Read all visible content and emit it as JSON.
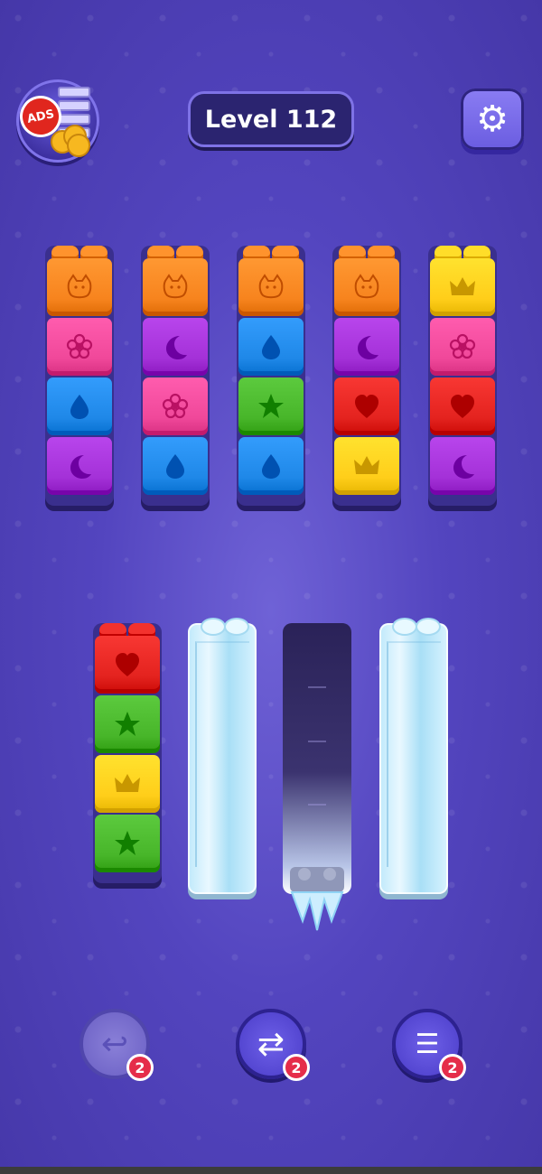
{
  "header": {
    "ads_badge": "ADS",
    "level_label": "Level 112",
    "settings_icon": "gear-icon"
  },
  "colors": {
    "orange": "#f7841e",
    "pink": "#f0489a",
    "blue": "#1f88e8",
    "purple": "#a431d8",
    "green": "#48b62a",
    "red": "#e4231f",
    "yellow": "#ffce1a"
  },
  "board": {
    "top_tubes": [
      {
        "blocks": [
          {
            "color": "orange",
            "icon": "cat"
          },
          {
            "color": "pink",
            "icon": "flower"
          },
          {
            "color": "blue",
            "icon": "drop"
          },
          {
            "color": "purple",
            "icon": "moon"
          }
        ]
      },
      {
        "blocks": [
          {
            "color": "orange",
            "icon": "cat"
          },
          {
            "color": "purple",
            "icon": "moon"
          },
          {
            "color": "pink",
            "icon": "flower"
          },
          {
            "color": "blue",
            "icon": "drop"
          }
        ]
      },
      {
        "blocks": [
          {
            "color": "orange",
            "icon": "cat"
          },
          {
            "color": "blue",
            "icon": "drop"
          },
          {
            "color": "green",
            "icon": "star"
          },
          {
            "color": "blue",
            "icon": "drop"
          }
        ]
      },
      {
        "blocks": [
          {
            "color": "orange",
            "icon": "cat"
          },
          {
            "color": "purple",
            "icon": "moon"
          },
          {
            "color": "red",
            "icon": "heart"
          },
          {
            "color": "yellow",
            "icon": "crown"
          }
        ]
      },
      {
        "blocks": [
          {
            "color": "yellow",
            "icon": "crown"
          },
          {
            "color": "pink",
            "icon": "flower"
          },
          {
            "color": "red",
            "icon": "heart"
          },
          {
            "color": "purple",
            "icon": "moon"
          }
        ]
      }
    ],
    "bottom_tubes": [
      {
        "kind": "blocks",
        "blocks": [
          {
            "color": "red",
            "icon": "heart"
          },
          {
            "color": "green",
            "icon": "star"
          },
          {
            "color": "yellow",
            "icon": "crown"
          },
          {
            "color": "green",
            "icon": "star"
          }
        ]
      },
      {
        "kind": "frozen"
      },
      {
        "kind": "empty-dark"
      },
      {
        "kind": "frozen"
      }
    ]
  },
  "powerups": {
    "undo": {
      "icon": "undo-icon",
      "count": "2"
    },
    "shuffle": {
      "icon": "shuffle-icon",
      "count": "2"
    },
    "add_tube": {
      "icon": "stack-icon",
      "count": "2"
    }
  }
}
